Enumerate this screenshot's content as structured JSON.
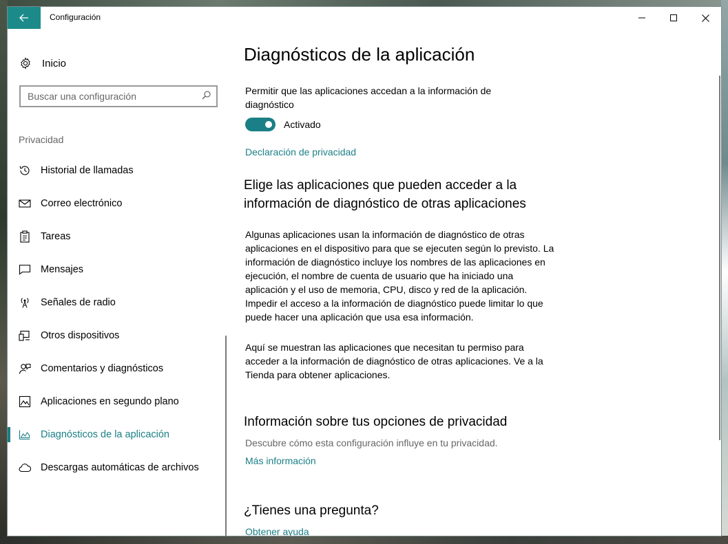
{
  "window": {
    "title": "Configuración"
  },
  "sidebar": {
    "home_label": "Inicio",
    "search_placeholder": "Buscar una configuración",
    "section_label": "Privacidad",
    "items": [
      {
        "label": "Historial de llamadas",
        "icon": "history-icon",
        "active": false
      },
      {
        "label": "Correo electrónico",
        "icon": "mail-icon",
        "active": false
      },
      {
        "label": "Tareas",
        "icon": "clipboard-icon",
        "active": false
      },
      {
        "label": "Mensajes",
        "icon": "message-icon",
        "active": false
      },
      {
        "label": "Señales de radio",
        "icon": "radio-tower-icon",
        "active": false
      },
      {
        "label": "Otros dispositivos",
        "icon": "devices-icon",
        "active": false
      },
      {
        "label": "Comentarios y diagnósticos",
        "icon": "feedback-icon",
        "active": false
      },
      {
        "label": "Aplicaciones en segundo plano",
        "icon": "background-apps-icon",
        "active": false
      },
      {
        "label": "Diagnósticos de la aplicación",
        "icon": "app-diagnostics-icon",
        "active": true
      },
      {
        "label": "Descargas automáticas de archivos",
        "icon": "cloud-icon",
        "active": false
      }
    ]
  },
  "main": {
    "title": "Diagnósticos de la aplicación",
    "toggle_description": "Permitir que las aplicaciones accedan a la información de diagnóstico",
    "toggle_state": "Activado",
    "privacy_link": "Declaración de privacidad",
    "choose_heading": "Elige las aplicaciones que pueden acceder a la información de diagnóstico de otras aplicaciones",
    "paragraph1": "Algunas aplicaciones usan la información de diagnóstico de otras aplicaciones en el dispositivo para que se ejecuten según lo previsto. La información de diagnóstico incluye los nombres de las aplicaciones en ejecución, el nombre de cuenta de usuario que ha iniciado una aplicación y el uso de memoria, CPU, disco y red de la aplicación. Impedir el acceso a la información de diagnóstico puede limitar lo que puede hacer una aplicación que usa esa información.",
    "paragraph2": "Aquí se muestran las aplicaciones que necesitan tu permiso para acceder a la información de diagnóstico de otras aplicaciones. Ve a la Tienda para obtener aplicaciones.",
    "info_heading": "Información sobre tus opciones de privacidad",
    "info_description": "Descubre cómo esta configuración influye en tu privacidad.",
    "more_info_link": "Más información",
    "question_heading": "¿Tienes una pregunta?",
    "help_link": "Obtener ayuda"
  },
  "colors": {
    "accent": "#1a7f86",
    "title_back_button": "#1d8a8a"
  }
}
